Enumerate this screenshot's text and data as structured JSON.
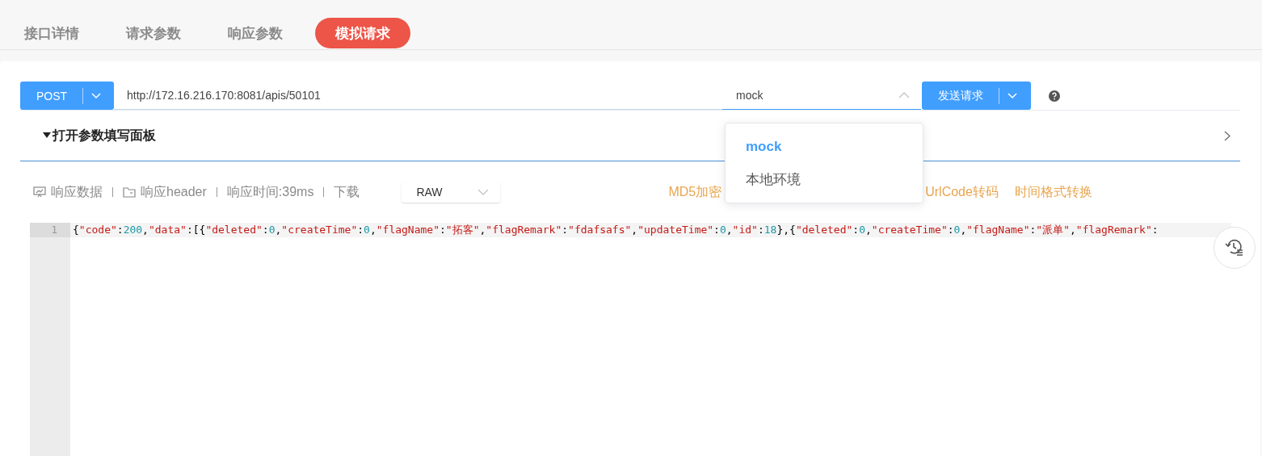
{
  "tabs": [
    {
      "label": "接口详情",
      "selected": false
    },
    {
      "label": "请求参数",
      "selected": false
    },
    {
      "label": "响应参数",
      "selected": false
    },
    {
      "label": "模拟请求",
      "selected": true
    }
  ],
  "request": {
    "method": "POST",
    "url": "http://172.16.216.170:8081/apis/50101",
    "environment": "mock",
    "send_label": "发送请求"
  },
  "environment_menu": {
    "expanded": true,
    "options": [
      {
        "label": "mock",
        "selected": true
      },
      {
        "label": "本地环境",
        "selected": false
      }
    ]
  },
  "param_panel": {
    "label": "打开参数填写面板"
  },
  "response_toolbar": {
    "items": [
      {
        "kind": "icon-link",
        "label": "响应数据"
      },
      {
        "kind": "icon-link",
        "label": "响应header"
      },
      {
        "kind": "text",
        "label": "响应时间:39ms"
      },
      {
        "kind": "link",
        "label": "下载"
      }
    ],
    "format": "RAW",
    "tools": [
      {
        "label": "MD5加密"
      },
      {
        "label": "UrlCode转码"
      },
      {
        "label": "时间格式转换"
      }
    ]
  },
  "editor": {
    "lines": [
      {
        "number": "1",
        "tokens": [
          {
            "kind": "punct",
            "text": "{"
          },
          {
            "kind": "string",
            "text": "\"code\""
          },
          {
            "kind": "punct",
            "text": ":"
          },
          {
            "kind": "number",
            "text": "200"
          },
          {
            "kind": "punct",
            "text": ","
          },
          {
            "kind": "string",
            "text": "\"data\""
          },
          {
            "kind": "punct",
            "text": ":[{"
          },
          {
            "kind": "string",
            "text": "\"deleted\""
          },
          {
            "kind": "punct",
            "text": ":"
          },
          {
            "kind": "number",
            "text": "0"
          },
          {
            "kind": "punct",
            "text": ","
          },
          {
            "kind": "string",
            "text": "\"createTime\""
          },
          {
            "kind": "punct",
            "text": ":"
          },
          {
            "kind": "number",
            "text": "0"
          },
          {
            "kind": "punct",
            "text": ","
          },
          {
            "kind": "string",
            "text": "\"flagName\""
          },
          {
            "kind": "punct",
            "text": ":"
          },
          {
            "kind": "string",
            "text": "\"拓客\""
          },
          {
            "kind": "punct",
            "text": ","
          },
          {
            "kind": "string",
            "text": "\"flagRemark\""
          },
          {
            "kind": "punct",
            "text": ":"
          },
          {
            "kind": "string",
            "text": "\"fdafsafs\""
          },
          {
            "kind": "punct",
            "text": ","
          },
          {
            "kind": "string",
            "text": "\"updateTime\""
          },
          {
            "kind": "punct",
            "text": ":"
          },
          {
            "kind": "number",
            "text": "0"
          },
          {
            "kind": "punct",
            "text": ","
          },
          {
            "kind": "string",
            "text": "\"id\""
          },
          {
            "kind": "punct",
            "text": ":"
          },
          {
            "kind": "number",
            "text": "18"
          },
          {
            "kind": "punct",
            "text": "},{"
          },
          {
            "kind": "string",
            "text": "\"deleted\""
          },
          {
            "kind": "punct",
            "text": ":"
          },
          {
            "kind": "number",
            "text": "0"
          },
          {
            "kind": "punct",
            "text": ","
          },
          {
            "kind": "string",
            "text": "\"createTime\""
          },
          {
            "kind": "punct",
            "text": ":"
          },
          {
            "kind": "number",
            "text": "0"
          },
          {
            "kind": "punct",
            "text": ","
          },
          {
            "kind": "string",
            "text": "\"flagName\""
          },
          {
            "kind": "punct",
            "text": ":"
          },
          {
            "kind": "string",
            "text": "\"派单\""
          },
          {
            "kind": "punct",
            "text": ","
          },
          {
            "kind": "string",
            "text": "\"flagRemark\""
          },
          {
            "kind": "punct",
            "text": ":"
          }
        ]
      }
    ]
  }
}
